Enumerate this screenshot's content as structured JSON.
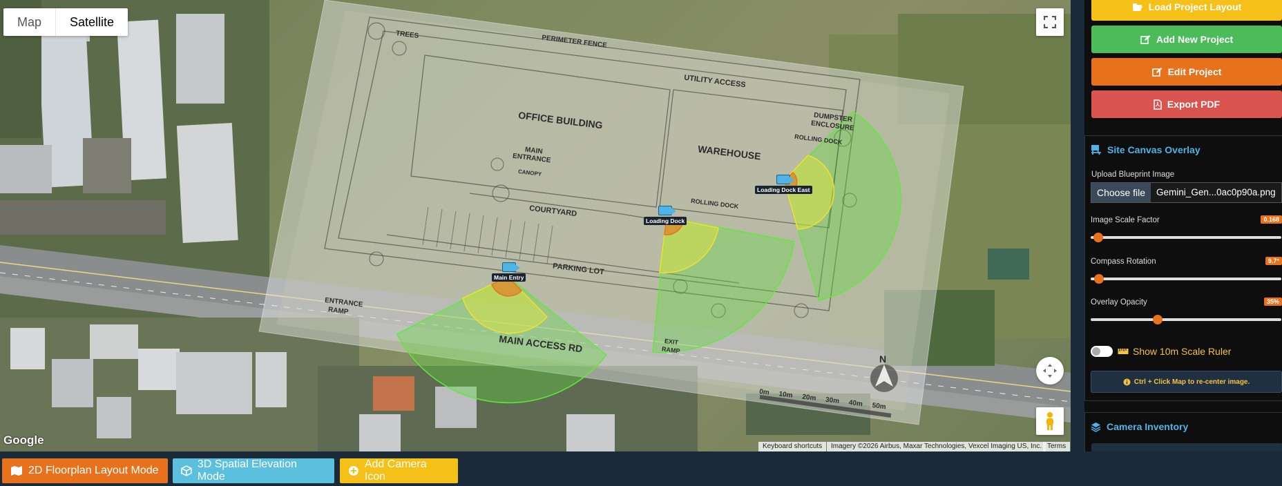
{
  "map": {
    "type_control": {
      "map_label": "Map",
      "satellite_label": "Satellite",
      "selected": "Satellite"
    },
    "google_logo": "Google",
    "attribution": {
      "keyboard_shortcuts": "Keyboard shortcuts",
      "imagery": "Imagery ©2026 Airbus, Maxar Technologies, Vexcel Imaging US, Inc.",
      "terms": "Terms"
    },
    "blueprint_labels": {
      "trees": "TREES",
      "perimeter_fence": "PERIMETER FENCE",
      "utility_access": "UTILITY ACCESS",
      "office_building": "OFFICE BUILDING",
      "dumpster": "DUMPSTER",
      "enclosure": "ENCLOSURE",
      "warehouse": "WAREHOUSE",
      "main": "MAIN",
      "entrance": "ENTRANCE",
      "canopy": "CANOPY",
      "rolling_dock_1": "ROLLING DOCK",
      "rolling_dock_2": "ROLLING DOCK",
      "courtyard": "COURTYARD",
      "parking_lot": "PARKING LOT",
      "entrance_ramp_1": "ENTRANCE",
      "entrance_ramp_2": "RAMP",
      "main_access_rd": "MAIN ACCESS RD",
      "exit": "EXIT",
      "ramp": "RAMP",
      "north": "N",
      "scale": [
        "0m",
        "10m",
        "20m",
        "30m",
        "40m",
        "50m"
      ]
    },
    "cameras": [
      {
        "label": "Main Entry"
      },
      {
        "label": "Loading Dock"
      },
      {
        "label": "Loading Dock East"
      }
    ],
    "overlay_opacity_percent": 35
  },
  "bottombar": {
    "floorplan_mode": "2D Floorplan Layout Mode",
    "spatial_mode": "3D Spatial Elevation Mode",
    "add_camera": "Add Camera Icon"
  },
  "sidebar": {
    "load_project": "Load Project Layout",
    "add_project": "Add New Project",
    "edit_project": "Edit Project",
    "export_pdf": "Export PDF",
    "site_canvas": {
      "title": "Site Canvas Overlay",
      "upload_label": "Upload Blueprint Image",
      "choose_file": "Choose file",
      "file_name": "Gemini_Gen...0ac0p90a.png",
      "scale_label": "Image Scale Factor",
      "scale_value": "0.168",
      "scale_fraction": 0.04,
      "rotation_label": "Compass Rotation",
      "rotation_value": "9.7°",
      "rotation_fraction": 0.045,
      "opacity_label": "Overlay Opacity",
      "opacity_value": "35%",
      "opacity_fraction": 0.35,
      "ruler_label": "Show 10m Scale Ruler",
      "ruler_on": false,
      "tip": "Ctrl + Click Map to re-center image."
    },
    "camera_inventory": {
      "title": "Camera Inventory"
    }
  },
  "colors": {
    "load": "#f5c018",
    "add": "#4cbb5a",
    "edit": "#e8721c",
    "export": "#d9534f",
    "mode2d": "#e8721c",
    "mode3d": "#5bc0de",
    "addcam": "#f5c018",
    "accent": "#4fb3e8"
  }
}
